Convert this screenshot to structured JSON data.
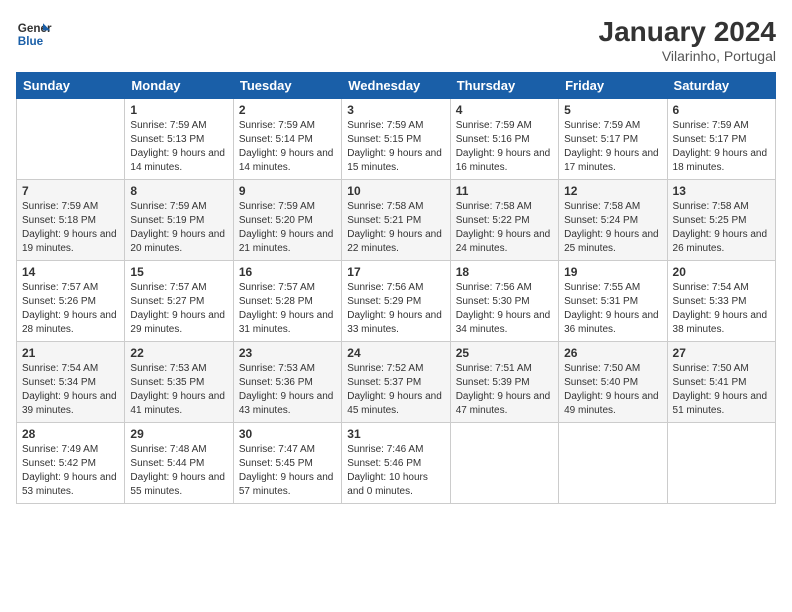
{
  "logo": {
    "text1": "General",
    "text2": "Blue"
  },
  "title": "January 2024",
  "location": "Vilarinho, Portugal",
  "days_of_week": [
    "Sunday",
    "Monday",
    "Tuesday",
    "Wednesday",
    "Thursday",
    "Friday",
    "Saturday"
  ],
  "weeks": [
    [
      {
        "num": "",
        "sunrise": "",
        "sunset": "",
        "daylight": ""
      },
      {
        "num": "1",
        "sunrise": "Sunrise: 7:59 AM",
        "sunset": "Sunset: 5:13 PM",
        "daylight": "Daylight: 9 hours and 14 minutes."
      },
      {
        "num": "2",
        "sunrise": "Sunrise: 7:59 AM",
        "sunset": "Sunset: 5:14 PM",
        "daylight": "Daylight: 9 hours and 14 minutes."
      },
      {
        "num": "3",
        "sunrise": "Sunrise: 7:59 AM",
        "sunset": "Sunset: 5:15 PM",
        "daylight": "Daylight: 9 hours and 15 minutes."
      },
      {
        "num": "4",
        "sunrise": "Sunrise: 7:59 AM",
        "sunset": "Sunset: 5:16 PM",
        "daylight": "Daylight: 9 hours and 16 minutes."
      },
      {
        "num": "5",
        "sunrise": "Sunrise: 7:59 AM",
        "sunset": "Sunset: 5:17 PM",
        "daylight": "Daylight: 9 hours and 17 minutes."
      },
      {
        "num": "6",
        "sunrise": "Sunrise: 7:59 AM",
        "sunset": "Sunset: 5:17 PM",
        "daylight": "Daylight: 9 hours and 18 minutes."
      }
    ],
    [
      {
        "num": "7",
        "sunrise": "Sunrise: 7:59 AM",
        "sunset": "Sunset: 5:18 PM",
        "daylight": "Daylight: 9 hours and 19 minutes."
      },
      {
        "num": "8",
        "sunrise": "Sunrise: 7:59 AM",
        "sunset": "Sunset: 5:19 PM",
        "daylight": "Daylight: 9 hours and 20 minutes."
      },
      {
        "num": "9",
        "sunrise": "Sunrise: 7:59 AM",
        "sunset": "Sunset: 5:20 PM",
        "daylight": "Daylight: 9 hours and 21 minutes."
      },
      {
        "num": "10",
        "sunrise": "Sunrise: 7:58 AM",
        "sunset": "Sunset: 5:21 PM",
        "daylight": "Daylight: 9 hours and 22 minutes."
      },
      {
        "num": "11",
        "sunrise": "Sunrise: 7:58 AM",
        "sunset": "Sunset: 5:22 PM",
        "daylight": "Daylight: 9 hours and 24 minutes."
      },
      {
        "num": "12",
        "sunrise": "Sunrise: 7:58 AM",
        "sunset": "Sunset: 5:24 PM",
        "daylight": "Daylight: 9 hours and 25 minutes."
      },
      {
        "num": "13",
        "sunrise": "Sunrise: 7:58 AM",
        "sunset": "Sunset: 5:25 PM",
        "daylight": "Daylight: 9 hours and 26 minutes."
      }
    ],
    [
      {
        "num": "14",
        "sunrise": "Sunrise: 7:57 AM",
        "sunset": "Sunset: 5:26 PM",
        "daylight": "Daylight: 9 hours and 28 minutes."
      },
      {
        "num": "15",
        "sunrise": "Sunrise: 7:57 AM",
        "sunset": "Sunset: 5:27 PM",
        "daylight": "Daylight: 9 hours and 29 minutes."
      },
      {
        "num": "16",
        "sunrise": "Sunrise: 7:57 AM",
        "sunset": "Sunset: 5:28 PM",
        "daylight": "Daylight: 9 hours and 31 minutes."
      },
      {
        "num": "17",
        "sunrise": "Sunrise: 7:56 AM",
        "sunset": "Sunset: 5:29 PM",
        "daylight": "Daylight: 9 hours and 33 minutes."
      },
      {
        "num": "18",
        "sunrise": "Sunrise: 7:56 AM",
        "sunset": "Sunset: 5:30 PM",
        "daylight": "Daylight: 9 hours and 34 minutes."
      },
      {
        "num": "19",
        "sunrise": "Sunrise: 7:55 AM",
        "sunset": "Sunset: 5:31 PM",
        "daylight": "Daylight: 9 hours and 36 minutes."
      },
      {
        "num": "20",
        "sunrise": "Sunrise: 7:54 AM",
        "sunset": "Sunset: 5:33 PM",
        "daylight": "Daylight: 9 hours and 38 minutes."
      }
    ],
    [
      {
        "num": "21",
        "sunrise": "Sunrise: 7:54 AM",
        "sunset": "Sunset: 5:34 PM",
        "daylight": "Daylight: 9 hours and 39 minutes."
      },
      {
        "num": "22",
        "sunrise": "Sunrise: 7:53 AM",
        "sunset": "Sunset: 5:35 PM",
        "daylight": "Daylight: 9 hours and 41 minutes."
      },
      {
        "num": "23",
        "sunrise": "Sunrise: 7:53 AM",
        "sunset": "Sunset: 5:36 PM",
        "daylight": "Daylight: 9 hours and 43 minutes."
      },
      {
        "num": "24",
        "sunrise": "Sunrise: 7:52 AM",
        "sunset": "Sunset: 5:37 PM",
        "daylight": "Daylight: 9 hours and 45 minutes."
      },
      {
        "num": "25",
        "sunrise": "Sunrise: 7:51 AM",
        "sunset": "Sunset: 5:39 PM",
        "daylight": "Daylight: 9 hours and 47 minutes."
      },
      {
        "num": "26",
        "sunrise": "Sunrise: 7:50 AM",
        "sunset": "Sunset: 5:40 PM",
        "daylight": "Daylight: 9 hours and 49 minutes."
      },
      {
        "num": "27",
        "sunrise": "Sunrise: 7:50 AM",
        "sunset": "Sunset: 5:41 PM",
        "daylight": "Daylight: 9 hours and 51 minutes."
      }
    ],
    [
      {
        "num": "28",
        "sunrise": "Sunrise: 7:49 AM",
        "sunset": "Sunset: 5:42 PM",
        "daylight": "Daylight: 9 hours and 53 minutes."
      },
      {
        "num": "29",
        "sunrise": "Sunrise: 7:48 AM",
        "sunset": "Sunset: 5:44 PM",
        "daylight": "Daylight: 9 hours and 55 minutes."
      },
      {
        "num": "30",
        "sunrise": "Sunrise: 7:47 AM",
        "sunset": "Sunset: 5:45 PM",
        "daylight": "Daylight: 9 hours and 57 minutes."
      },
      {
        "num": "31",
        "sunrise": "Sunrise: 7:46 AM",
        "sunset": "Sunset: 5:46 PM",
        "daylight": "Daylight: 10 hours and 0 minutes."
      },
      {
        "num": "",
        "sunrise": "",
        "sunset": "",
        "daylight": ""
      },
      {
        "num": "",
        "sunrise": "",
        "sunset": "",
        "daylight": ""
      },
      {
        "num": "",
        "sunrise": "",
        "sunset": "",
        "daylight": ""
      }
    ]
  ]
}
